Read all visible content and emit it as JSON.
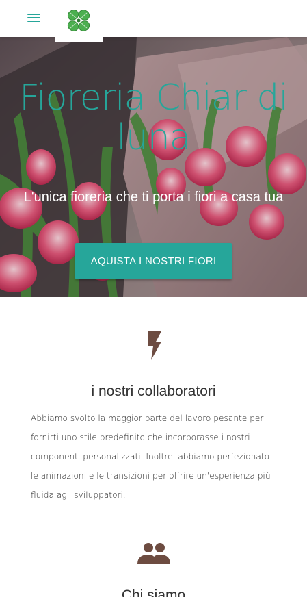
{
  "navbar": {
    "menu_icon": "hamburger-menu-icon",
    "logo_icon": "green-clover-logo-icon",
    "accent_color": "#26a69a"
  },
  "hero": {
    "title": "Fioreria Chiar di luna",
    "subtitle": "L'unica fioreria che ti porta i fiori a casa tua",
    "button_label": "AQUISTA I NOSTRI FIORI",
    "title_color": "#26a69a",
    "button_color": "#26a69a"
  },
  "features": [
    {
      "icon": "lightning-bolt-icon",
      "icon_color": "#6d4c41",
      "title": "i nostri collaboratori",
      "text": "Abbiamo svolto la maggior parte del lavoro pesante per fornirti uno stile predefinito che incorporasse i nostri componenti personalizzati. Inoltre, abbiamo perfezionato le animazioni e le transizioni per offrire un'esperienza più fluida agli sviluppatori."
    },
    {
      "icon": "group-people-icon",
      "icon_color": "#6d4c41",
      "title": "Chi siamo"
    }
  ]
}
